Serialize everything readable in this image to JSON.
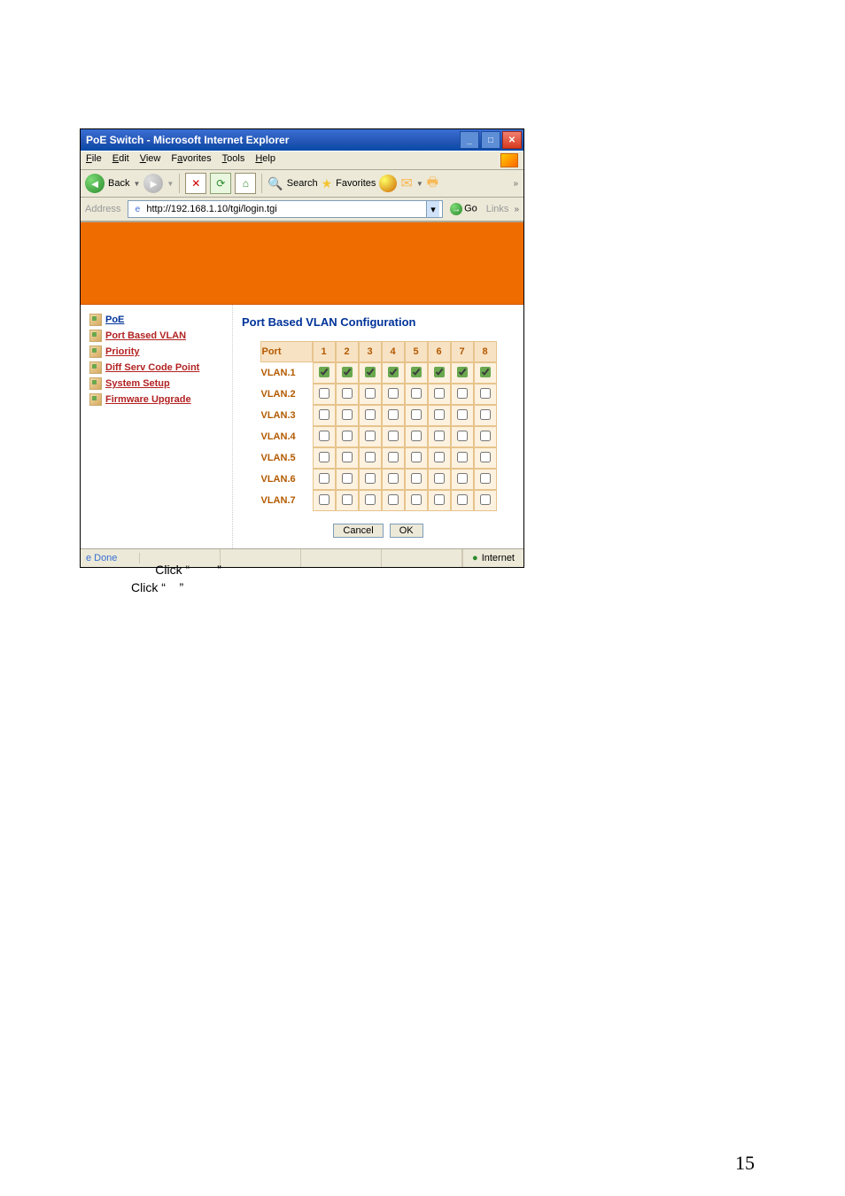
{
  "window": {
    "title": "PoE Switch - Microsoft Internet Explorer"
  },
  "menu": {
    "file": "File",
    "edit": "Edit",
    "view": "View",
    "favorites": "Favorites",
    "tools": "Tools",
    "help": "Help"
  },
  "toolbar": {
    "back": "Back",
    "search": "Search",
    "favorites": "Favorites"
  },
  "address": {
    "label": "Address",
    "url": "http://192.168.1.10/tgi/login.tgi",
    "go": "Go",
    "links": "Links"
  },
  "sidebar": {
    "items": [
      {
        "label": "PoE"
      },
      {
        "label": "Port Based VLAN"
      },
      {
        "label": "Priority"
      },
      {
        "label": "Diff Serv Code Point"
      },
      {
        "label": "System Setup"
      },
      {
        "label": "Firmware Upgrade"
      }
    ]
  },
  "panel": {
    "heading": "Port Based VLAN Configuration",
    "port_label": "Port",
    "ports": [
      "1",
      "2",
      "3",
      "4",
      "5",
      "6",
      "7",
      "8"
    ],
    "rows": [
      {
        "name": "VLAN.1",
        "checked": [
          true,
          true,
          true,
          true,
          true,
          true,
          true,
          true
        ]
      },
      {
        "name": "VLAN.2",
        "checked": [
          false,
          false,
          false,
          false,
          false,
          false,
          false,
          false
        ]
      },
      {
        "name": "VLAN.3",
        "checked": [
          false,
          false,
          false,
          false,
          false,
          false,
          false,
          false
        ]
      },
      {
        "name": "VLAN.4",
        "checked": [
          false,
          false,
          false,
          false,
          false,
          false,
          false,
          false
        ]
      },
      {
        "name": "VLAN.5",
        "checked": [
          false,
          false,
          false,
          false,
          false,
          false,
          false,
          false
        ]
      },
      {
        "name": "VLAN.6",
        "checked": [
          false,
          false,
          false,
          false,
          false,
          false,
          false,
          false
        ]
      },
      {
        "name": "VLAN.7",
        "checked": [
          false,
          false,
          false,
          false,
          false,
          false,
          false,
          false
        ]
      }
    ],
    "cancel": "Cancel",
    "ok": "OK"
  },
  "status": {
    "done": "Done",
    "zone": "Internet"
  },
  "caption": {
    "click": "Click",
    "q1": "“",
    "q2": "”",
    "q3": "“",
    "q4": "”"
  },
  "page_number": "15"
}
